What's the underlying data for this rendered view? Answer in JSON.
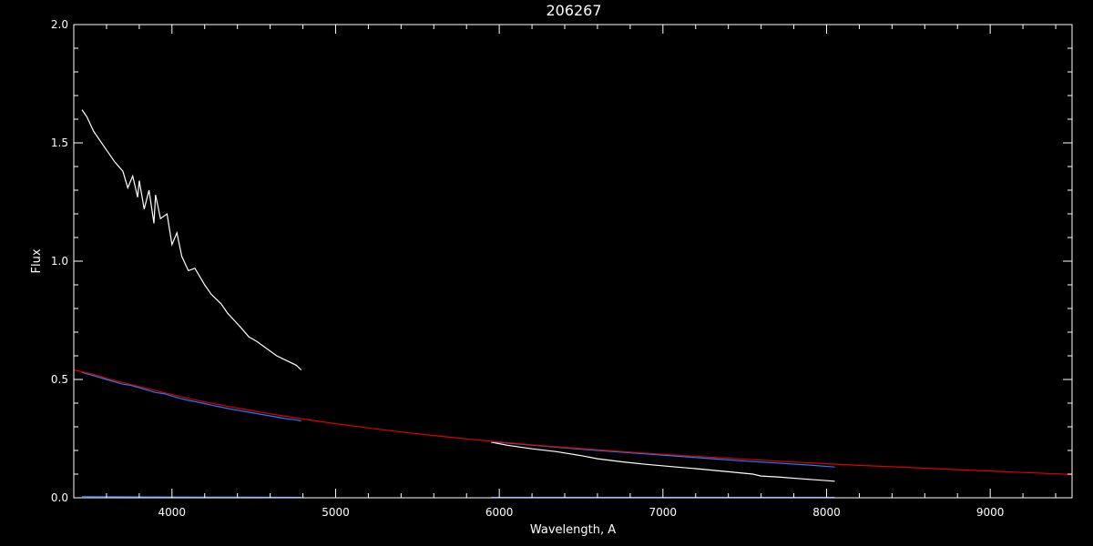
{
  "chart_data": {
    "type": "line",
    "title": "206267",
    "xlabel": "Wavelength, A",
    "ylabel": "Flux",
    "xlim": [
      3400,
      9500
    ],
    "ylim": [
      0,
      2.0
    ],
    "x_ticks": [
      "4000",
      "5000",
      "6000",
      "7000",
      "8000",
      "9000"
    ],
    "x_tick_values": [
      4000,
      5000,
      6000,
      7000,
      8000,
      9000
    ],
    "y_ticks": [
      "0.0",
      "0.5",
      "1.0",
      "1.5",
      "2.0"
    ],
    "y_tick_values": [
      0.0,
      0.5,
      1.0,
      1.5,
      2.0
    ],
    "grid": false,
    "background": "#000000",
    "axis_color": "#ffffff",
    "series": [
      {
        "color": "#ffffff",
        "x": [
          3450,
          3480,
          3520,
          3560,
          3600,
          3650,
          3700,
          3730,
          3760,
          3790,
          3800,
          3830,
          3860,
          3890,
          3900,
          3930,
          3970,
          4000,
          4030,
          4060,
          4100,
          4140,
          4200,
          4240,
          4300,
          4340,
          4380,
          4420,
          4470,
          4520,
          4580,
          4640,
          4700,
          4760,
          4790
        ],
        "y": [
          1.64,
          1.61,
          1.55,
          1.51,
          1.47,
          1.42,
          1.38,
          1.31,
          1.36,
          1.27,
          1.34,
          1.22,
          1.3,
          1.16,
          1.28,
          1.18,
          1.2,
          1.07,
          1.12,
          1.02,
          0.96,
          0.97,
          0.9,
          0.86,
          0.82,
          0.78,
          0.75,
          0.72,
          0.68,
          0.66,
          0.63,
          0.6,
          0.58,
          0.56,
          0.54
        ]
      },
      {
        "color": "#ffffff",
        "x": [
          5950,
          6050,
          6200,
          6350,
          6500,
          6600,
          6750,
          6900,
          7050,
          7200,
          7400,
          7550,
          7600,
          7700,
          7850,
          8050
        ],
        "y": [
          0.235,
          0.222,
          0.207,
          0.195,
          0.178,
          0.165,
          0.152,
          0.141,
          0.132,
          0.123,
          0.11,
          0.1,
          0.092,
          0.088,
          0.08,
          0.07
        ]
      },
      {
        "color": "#1f7fff",
        "x": [
          3450,
          3500,
          3550,
          3600,
          3650,
          3700,
          3750,
          3800,
          3850,
          3900,
          3950,
          4000,
          4050,
          4100,
          4150,
          4200,
          4250,
          4300,
          4350,
          4400,
          4450,
          4500,
          4550,
          4600,
          4650,
          4700,
          4750,
          4790
        ],
        "y": [
          0.53,
          0.52,
          0.51,
          0.5,
          0.49,
          0.48,
          0.475,
          0.465,
          0.455,
          0.445,
          0.44,
          0.43,
          0.42,
          0.412,
          0.405,
          0.398,
          0.39,
          0.383,
          0.376,
          0.37,
          0.364,
          0.358,
          0.352,
          0.346,
          0.34,
          0.334,
          0.33,
          0.325
        ]
      },
      {
        "color": "#1f7fff",
        "x": [
          5950,
          6100,
          6300,
          6500,
          6700,
          6900,
          7100,
          7300,
          7500,
          7700,
          7900,
          8050
        ],
        "y": [
          0.237,
          0.228,
          0.217,
          0.205,
          0.195,
          0.185,
          0.175,
          0.165,
          0.155,
          0.147,
          0.138,
          0.13
        ]
      },
      {
        "color": "#1f7fff",
        "x": [
          3450,
          3800,
          4200,
          4790
        ],
        "y": [
          0.005,
          0.004,
          0.003,
          0.002
        ]
      },
      {
        "color": "#1f7fff",
        "x": [
          5950,
          6500,
          7000,
          7500,
          8050
        ],
        "y": [
          0.002,
          0.002,
          0.002,
          0.002,
          0.002
        ]
      },
      {
        "color": "#e00000",
        "x": [
          3400,
          3500,
          3600,
          3700,
          3800,
          3900,
          4000,
          4100,
          4200,
          4300,
          4400,
          4500,
          4600,
          4700,
          4800,
          4900,
          5000,
          5200,
          5400,
          5600,
          5800,
          6000,
          6200,
          6400,
          6600,
          6800,
          7000,
          7200,
          7400,
          7600,
          7800,
          8000,
          8200,
          8400,
          8600,
          8800,
          9000,
          9200,
          9400,
          9500
        ],
        "y": [
          0.54,
          0.525,
          0.505,
          0.487,
          0.47,
          0.453,
          0.436,
          0.42,
          0.405,
          0.392,
          0.379,
          0.367,
          0.355,
          0.344,
          0.333,
          0.323,
          0.313,
          0.295,
          0.278,
          0.263,
          0.249,
          0.236,
          0.224,
          0.213,
          0.203,
          0.193,
          0.184,
          0.175,
          0.167,
          0.159,
          0.151,
          0.144,
          0.137,
          0.131,
          0.125,
          0.119,
          0.113,
          0.107,
          0.101,
          0.098
        ]
      }
    ]
  }
}
